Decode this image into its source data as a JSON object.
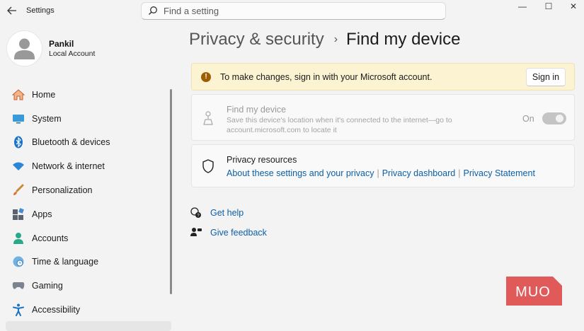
{
  "app": {
    "title": "Settings"
  },
  "search": {
    "placeholder": "Find a setting"
  },
  "window_controls": {
    "minimize": "—",
    "maximize": "☐",
    "close": "✕"
  },
  "user": {
    "name": "Pankil",
    "account_type": "Local Account"
  },
  "sidebar": {
    "items": [
      {
        "label": "Home",
        "icon": "home-icon"
      },
      {
        "label": "System",
        "icon": "system-display-icon"
      },
      {
        "label": "Bluetooth & devices",
        "icon": "bluetooth-icon"
      },
      {
        "label": "Network & internet",
        "icon": "wifi-icon"
      },
      {
        "label": "Personalization",
        "icon": "brush-icon"
      },
      {
        "label": "Apps",
        "icon": "apps-icon"
      },
      {
        "label": "Accounts",
        "icon": "accounts-icon"
      },
      {
        "label": "Time & language",
        "icon": "clock-globe-icon"
      },
      {
        "label": "Gaming",
        "icon": "gamepad-icon"
      },
      {
        "label": "Accessibility",
        "icon": "accessibility-icon"
      }
    ]
  },
  "breadcrumb": {
    "parent": "Privacy & security",
    "separator": "›",
    "current": "Find my device"
  },
  "banner": {
    "message": "To make changes, sign in with your Microsoft account.",
    "button": "Sign in",
    "icon": "warning-icon",
    "color": "#fcf3d3"
  },
  "find_my_device": {
    "title": "Find my device",
    "description": "Save this device's location when it's connected to the internet—go to account.microsoft.com to locate it",
    "state": "On",
    "enabled": false
  },
  "privacy_resources": {
    "title": "Privacy resources",
    "links": [
      "About these settings and your privacy",
      "Privacy dashboard",
      "Privacy Statement"
    ]
  },
  "help": {
    "get_help": "Get help",
    "give_feedback": "Give feedback"
  },
  "watermark": {
    "text": "MUO",
    "color": "#e15a5a"
  },
  "colors": {
    "accent": "#0a5fa6",
    "background": "#f3f3f3"
  }
}
